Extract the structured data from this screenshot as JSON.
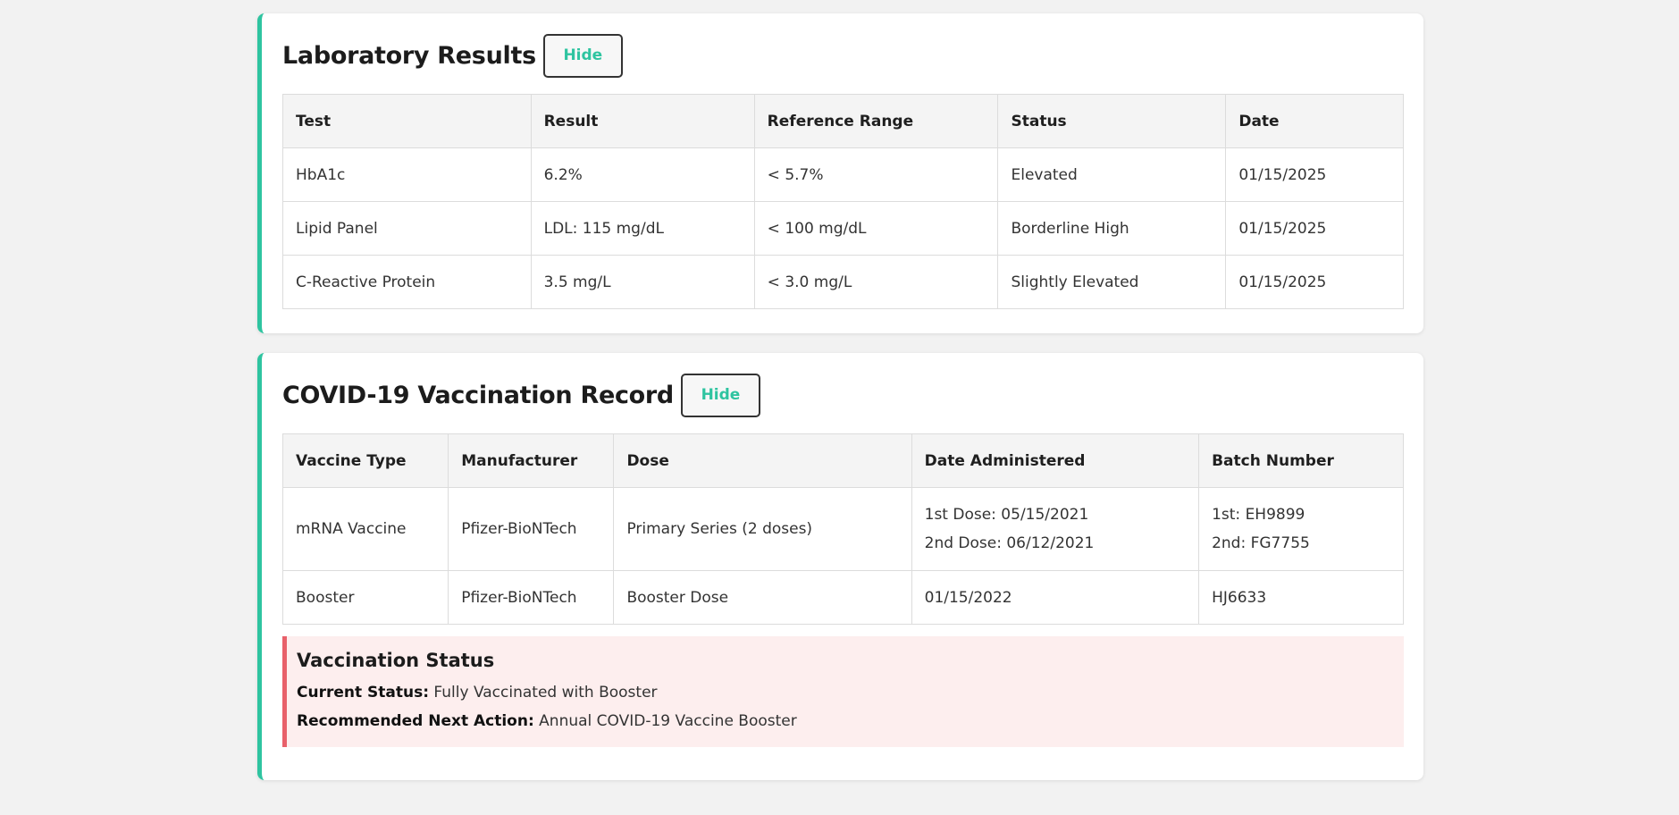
{
  "lab": {
    "title": "Laboratory Results",
    "hide_label": "Hide",
    "headers": [
      "Test",
      "Result",
      "Reference Range",
      "Status",
      "Date"
    ],
    "rows": [
      [
        "HbA1c",
        "6.2%",
        "< 5.7%",
        "Elevated",
        "01/15/2025"
      ],
      [
        "Lipid Panel",
        "LDL: 115 mg/dL",
        "< 100 mg/dL",
        "Borderline High",
        "01/15/2025"
      ],
      [
        "C-Reactive Protein",
        "3.5 mg/L",
        "< 3.0 mg/L",
        "Slightly Elevated",
        "01/15/2025"
      ]
    ]
  },
  "covid": {
    "title": "COVID-19 Vaccination Record",
    "hide_label": "Hide",
    "headers": [
      "Vaccine Type",
      "Manufacturer",
      "Dose",
      "Date Administered",
      "Batch Number"
    ],
    "rows": [
      {
        "type": "mRNA Vaccine",
        "manufacturer": "Pfizer-BioNTech",
        "dose": "Primary Series (2 doses)",
        "date_1": "1st Dose: 05/15/2021",
        "date_2": "2nd Dose: 06/12/2021",
        "batch_1": "1st: EH9899",
        "batch_2": "2nd: FG7755"
      },
      {
        "type": "Booster",
        "manufacturer": "Pfizer-BioNTech",
        "dose": "Booster Dose",
        "date": "01/15/2022",
        "batch": "HJ6633"
      }
    ],
    "status": {
      "title": "Vaccination Status",
      "current_label": "Current Status:",
      "current_value": "Fully Vaccinated with Booster",
      "next_label": "Recommended Next Action:",
      "next_value": "Annual COVID-19 Vaccine Booster"
    }
  },
  "colors": {
    "accent": "#2ec4a0",
    "alert_border": "#e8606a",
    "alert_bg": "#fdeeee",
    "page_bg": "#f2f2f2"
  }
}
